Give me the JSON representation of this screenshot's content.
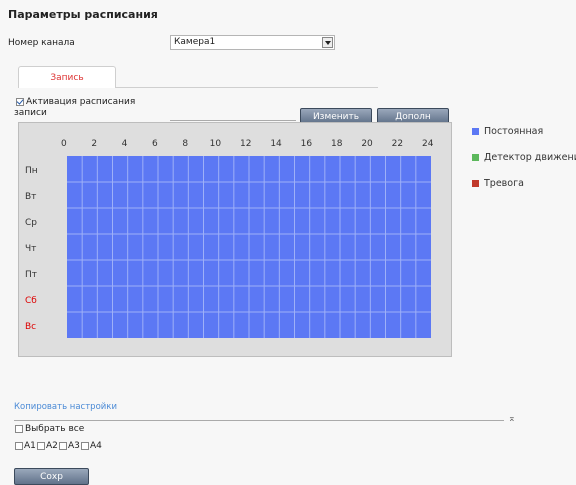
{
  "page": {
    "title": "Параметры расписания"
  },
  "channel": {
    "label": "Номер канала",
    "value": "Камера1"
  },
  "tabs": [
    {
      "label": "Запись"
    }
  ],
  "activation": {
    "label_line1": "Активация расписания",
    "label_line2": "записи",
    "checked": true
  },
  "buttons": {
    "edit": "Изменить",
    "advanced": "Дополн",
    "save": "Сохр"
  },
  "schedule": {
    "hours": [
      "0",
      "2",
      "4",
      "6",
      "8",
      "10",
      "12",
      "14",
      "16",
      "18",
      "20",
      "22",
      "24"
    ],
    "days": [
      "Пн",
      "Вт",
      "Ср",
      "Чт",
      "Пт",
      "Сб",
      "Вс"
    ],
    "weekend_color": "#dd0000",
    "fill_color": "#5c78f4"
  },
  "legend": [
    {
      "label": "Постоянная",
      "color": "#5c78f4"
    },
    {
      "label": "Детектор движения",
      "color": "#5cb85c"
    },
    {
      "label": "Тревога",
      "color": "#c0392b"
    }
  ],
  "copy": {
    "link": "Копировать настройки",
    "select_all": "Выбрать все",
    "channels": [
      "A1",
      "A2",
      "A3",
      "A4"
    ]
  }
}
